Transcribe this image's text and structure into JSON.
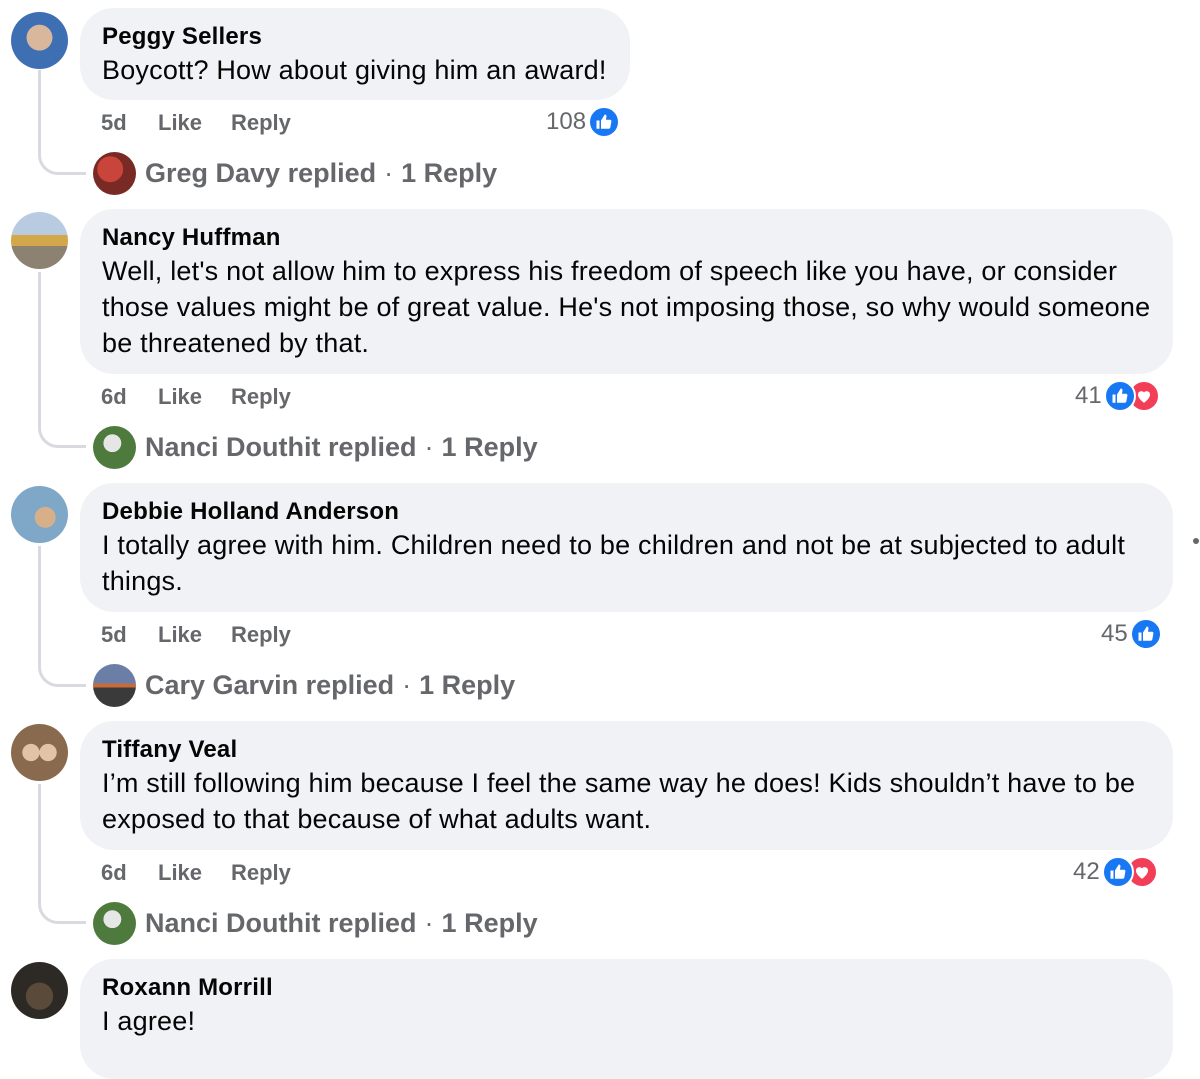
{
  "comments": [
    {
      "author": "Peggy Sellers",
      "text": "Boycott? How about giving him an award!",
      "time": "5d",
      "like": "Like",
      "reply": "Reply",
      "reaction_count": "108",
      "reactions": [
        "like"
      ],
      "replier": "Greg Davy",
      "replied_label": "replied",
      "reply_count": "1 Reply"
    },
    {
      "author": "Nancy Huffman",
      "text": "Well, let's not allow him to express his freedom of speech like you have, or consider those values might be of great value. He's not imposing those, so why would someone be threatened by that.",
      "time": "6d",
      "like": "Like",
      "reply": "Reply",
      "reaction_count": "41",
      "reactions": [
        "like",
        "love"
      ],
      "replier": "Nanci Douthit",
      "replied_label": "replied",
      "reply_count": "1 Reply"
    },
    {
      "author": "Debbie Holland Anderson",
      "text": "I totally agree with him. Children need to be children and not be at subjected to adult things.",
      "time": "5d",
      "like": "Like",
      "reply": "Reply",
      "reaction_count": "45",
      "reactions": [
        "like"
      ],
      "replier": "Cary Garvin",
      "replied_label": "replied",
      "reply_count": "1 Reply"
    },
    {
      "author": "Tiffany Veal",
      "text": "I’m still following him because I feel the same way he does! Kids shouldn’t have to be exposed to that because of what adults want.",
      "time": "6d",
      "like": "Like",
      "reply": "Reply",
      "reaction_count": "42",
      "reactions": [
        "like",
        "love"
      ],
      "replier": "Nanci Douthit",
      "replied_label": "replied",
      "reply_count": "1 Reply"
    },
    {
      "author": "Roxann Morrill",
      "text": "I agree!"
    }
  ],
  "colors": {
    "bubble": "#f0f2f5",
    "meta": "#65676b",
    "like": "#1877f2",
    "love": "#f33e58"
  }
}
